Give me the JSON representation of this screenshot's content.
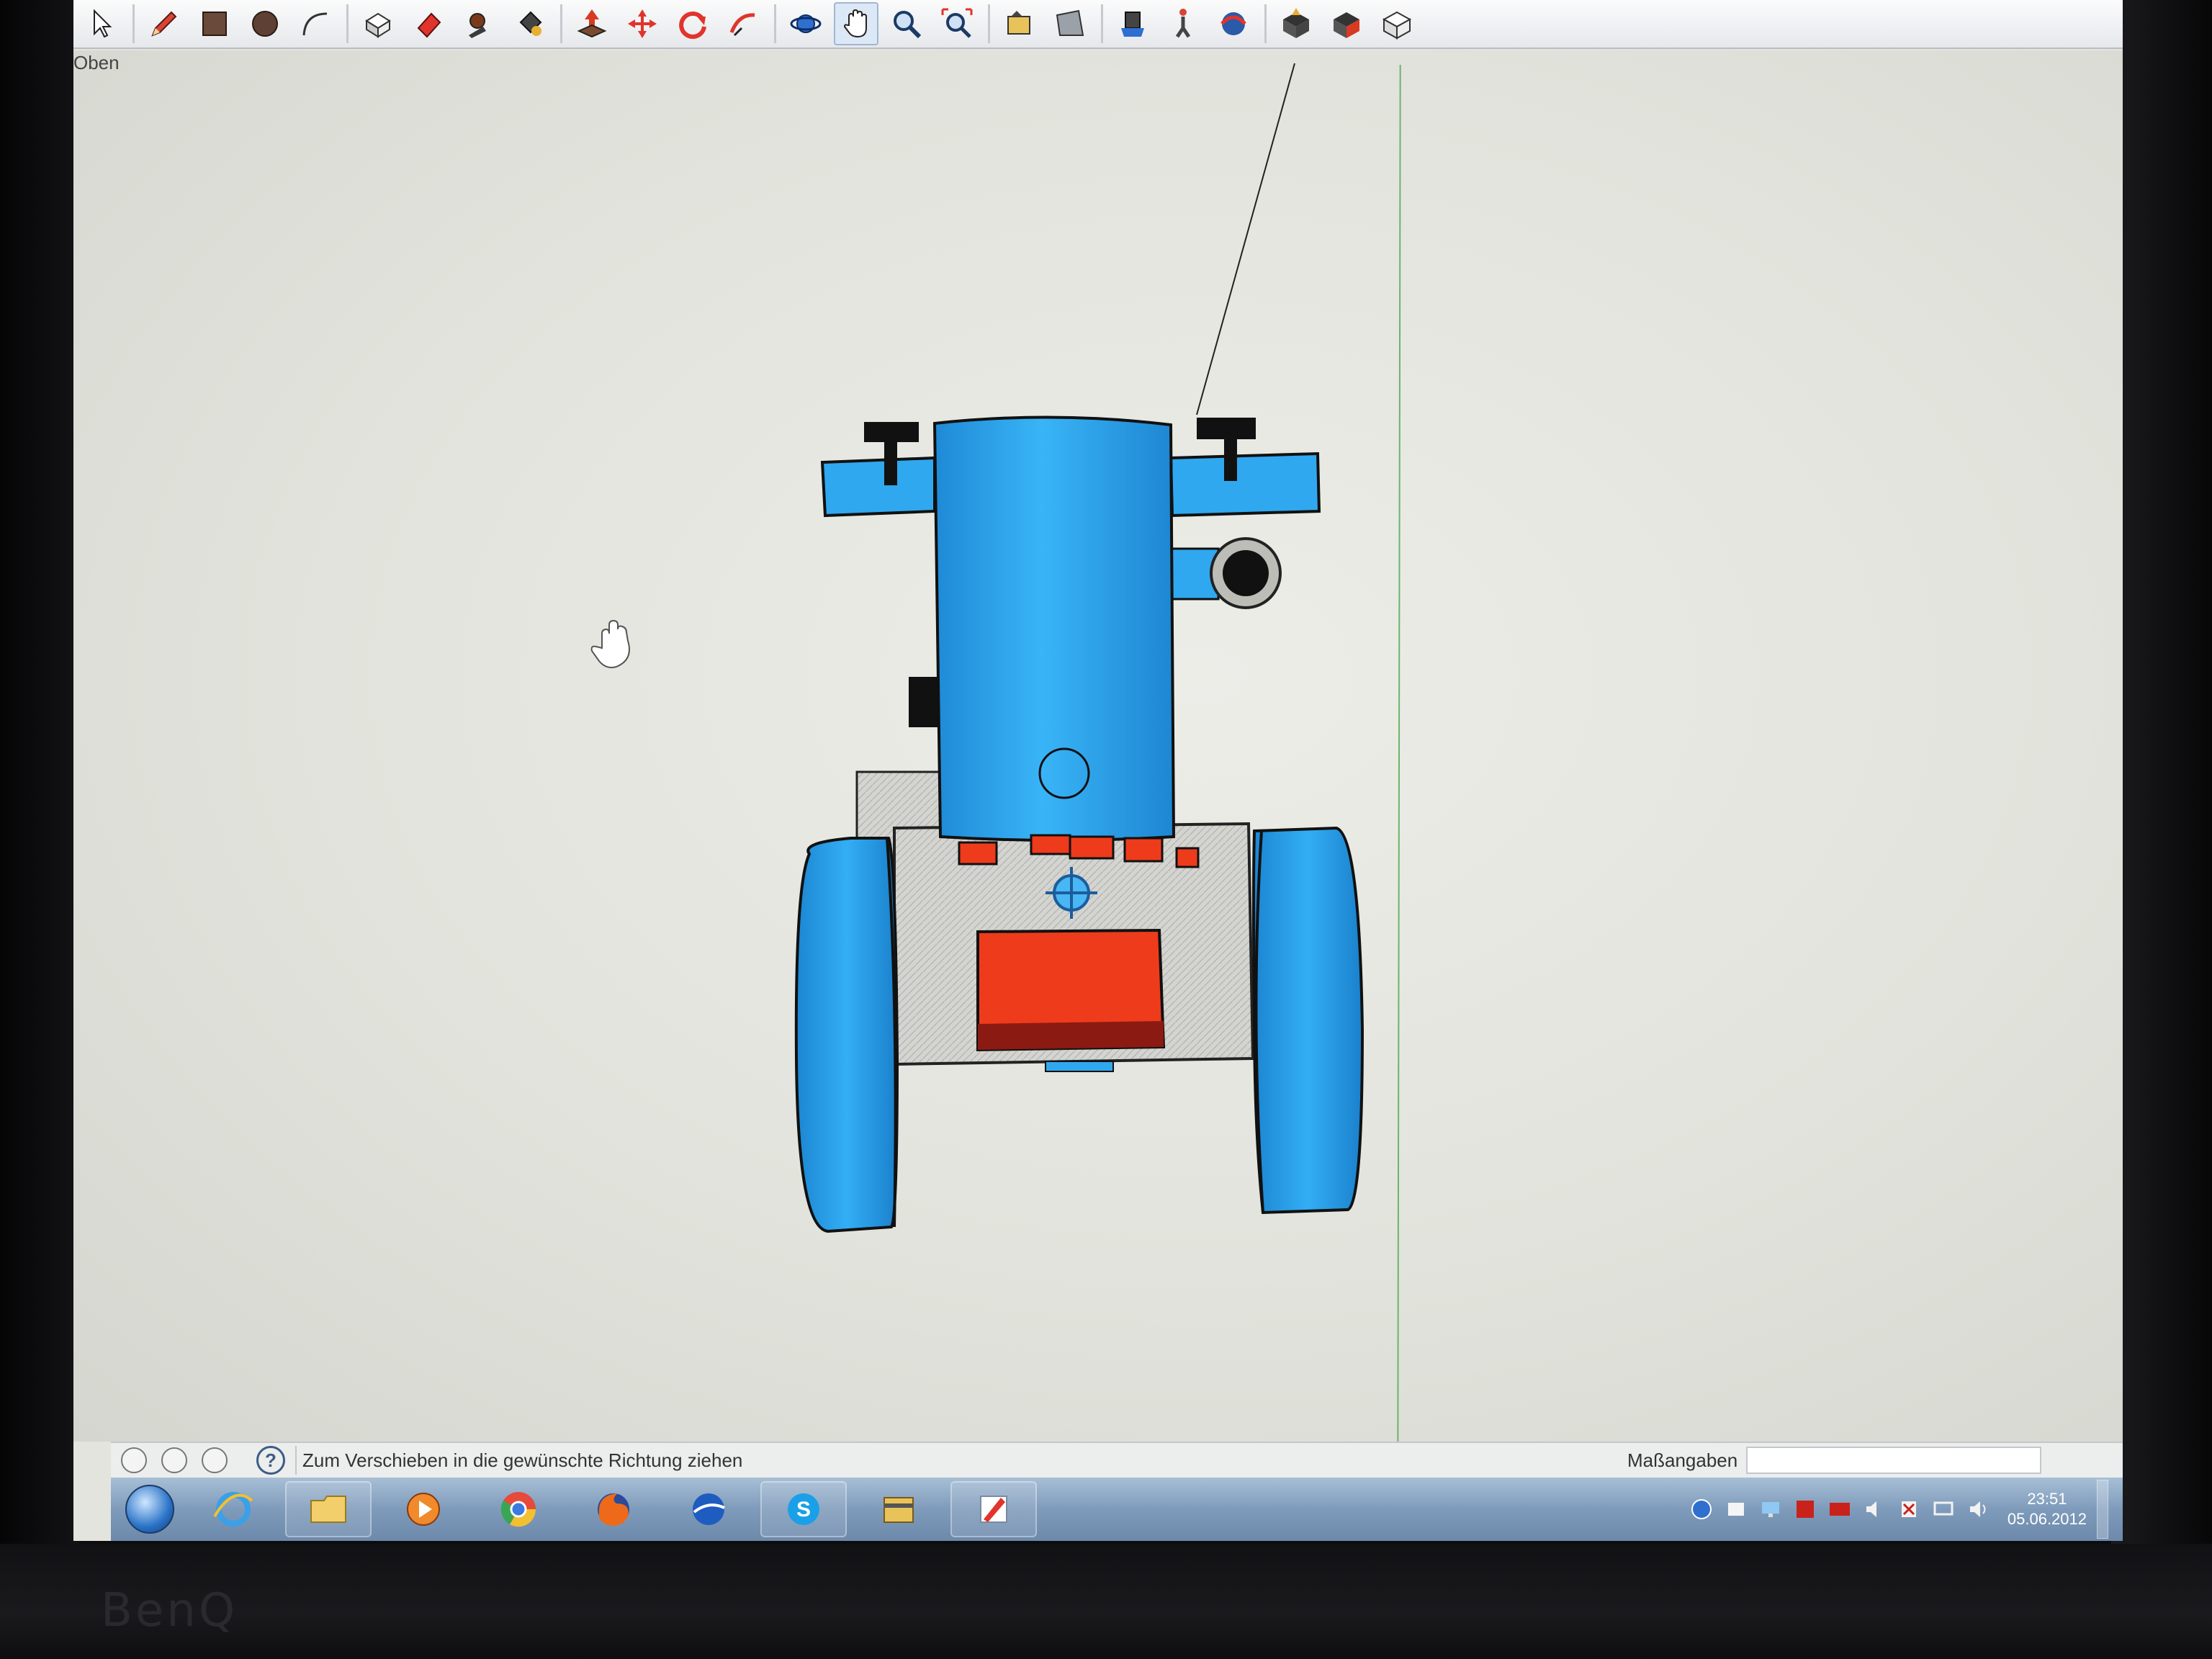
{
  "toolbar": {
    "tools": [
      {
        "icon": "select-arrow-icon",
        "active": false
      },
      {
        "icon": "pencil-icon",
        "active": false
      },
      {
        "icon": "rectangle-icon",
        "active": false
      },
      {
        "icon": "circle-icon",
        "active": false
      },
      {
        "icon": "arc-icon",
        "active": false
      },
      {
        "icon": "make-component-icon",
        "active": false
      },
      {
        "icon": "eraser-icon",
        "active": false
      },
      {
        "icon": "tape-measure-icon",
        "active": false
      },
      {
        "icon": "paint-bucket-icon",
        "active": false
      },
      {
        "icon": "push-pull-icon",
        "active": false
      },
      {
        "icon": "move-icon",
        "active": false
      },
      {
        "icon": "rotate-icon",
        "active": false
      },
      {
        "icon": "follow-me-icon",
        "active": false
      },
      {
        "icon": "orbit-icon",
        "active": false
      },
      {
        "icon": "pan-hand-icon",
        "active": true
      },
      {
        "icon": "zoom-icon",
        "active": false
      },
      {
        "icon": "zoom-extents-icon",
        "active": false
      },
      {
        "icon": "previous-view-icon",
        "active": false
      },
      {
        "icon": "next-view-icon",
        "active": false
      },
      {
        "icon": "position-camera-icon",
        "active": false
      },
      {
        "icon": "walk-icon",
        "active": false
      },
      {
        "icon": "look-around-icon",
        "active": false
      },
      {
        "icon": "get-models-icon",
        "active": false
      },
      {
        "icon": "share-model-icon",
        "active": false
      },
      {
        "icon": "share-component-icon",
        "active": false
      }
    ]
  },
  "viewport": {
    "scene_label": "Oben"
  },
  "colors": {
    "model_blue": "#2fa8f0",
    "model_red": "#ee3b1c",
    "model_gray": "#cfcfcb",
    "background": "#e3e4de"
  },
  "statusbar": {
    "hint": "Zum Verschieben in die gewünschte Richtung ziehen",
    "measurements_label": "Maßangaben",
    "measurements_value": ""
  },
  "taskbar": {
    "apps": [
      {
        "icon": "internet-explorer-icon",
        "pinned": false
      },
      {
        "icon": "file-explorer-icon",
        "pinned": true
      },
      {
        "icon": "media-player-icon",
        "pinned": false
      },
      {
        "icon": "chrome-icon",
        "pinned": false
      },
      {
        "icon": "firefox-icon",
        "pinned": false
      },
      {
        "icon": "google-earth-icon",
        "pinned": false
      },
      {
        "icon": "skype-icon",
        "pinned": true
      },
      {
        "icon": "archive-icon",
        "pinned": false
      },
      {
        "icon": "sketchup-icon",
        "pinned": true
      }
    ],
    "tray_icons": [
      "network-icon",
      "folder-icon",
      "monitor-icon",
      "acrobat-icon",
      "ati-icon",
      "speaker-icon",
      "flag-icon",
      "display-icon",
      "volume-icon"
    ],
    "clock_time": "23:51",
    "clock_date": "05.06.2012"
  },
  "monitor": {
    "brand": "BenQ"
  }
}
